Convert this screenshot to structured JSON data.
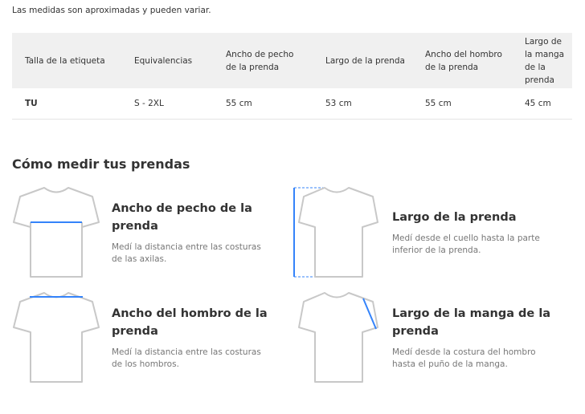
{
  "note": "Las medidas son aproximadas y pueden variar.",
  "table": {
    "headers": [
      "Talla de la etiqueta",
      "Equivalencias",
      "Ancho de pecho de la prenda",
      "Largo de la prenda",
      "Ancho del hombro de la prenda",
      "Largo de la manga de la prenda"
    ],
    "rows": [
      [
        "TU",
        "S - 2XL",
        "55 cm",
        "53 cm",
        "55 cm",
        "45 cm"
      ]
    ]
  },
  "section_title": "Cómo medir tus prendas",
  "measures": [
    {
      "title": "Ancho de pecho de la prenda",
      "desc": "Medí la distancia entre las costuras de las axilas.",
      "icon": "tshirt-chest-icon"
    },
    {
      "title": "Largo de la prenda",
      "desc": "Medí desde el cuello hasta la parte inferior de la prenda.",
      "icon": "tshirt-length-icon"
    },
    {
      "title": "Ancho del hombro de la prenda",
      "desc": "Medí la distancia entre las costuras de los hombros.",
      "icon": "tshirt-shoulder-icon"
    },
    {
      "title": "Largo de la manga de la prenda",
      "desc": "Medí desde la costura del hombro hasta el puño de la manga.",
      "icon": "tshirt-sleeve-icon"
    }
  ],
  "colors": {
    "accent": "#3483fa",
    "header_bg": "#f0f0f0",
    "outline": "#c8c8c8"
  }
}
